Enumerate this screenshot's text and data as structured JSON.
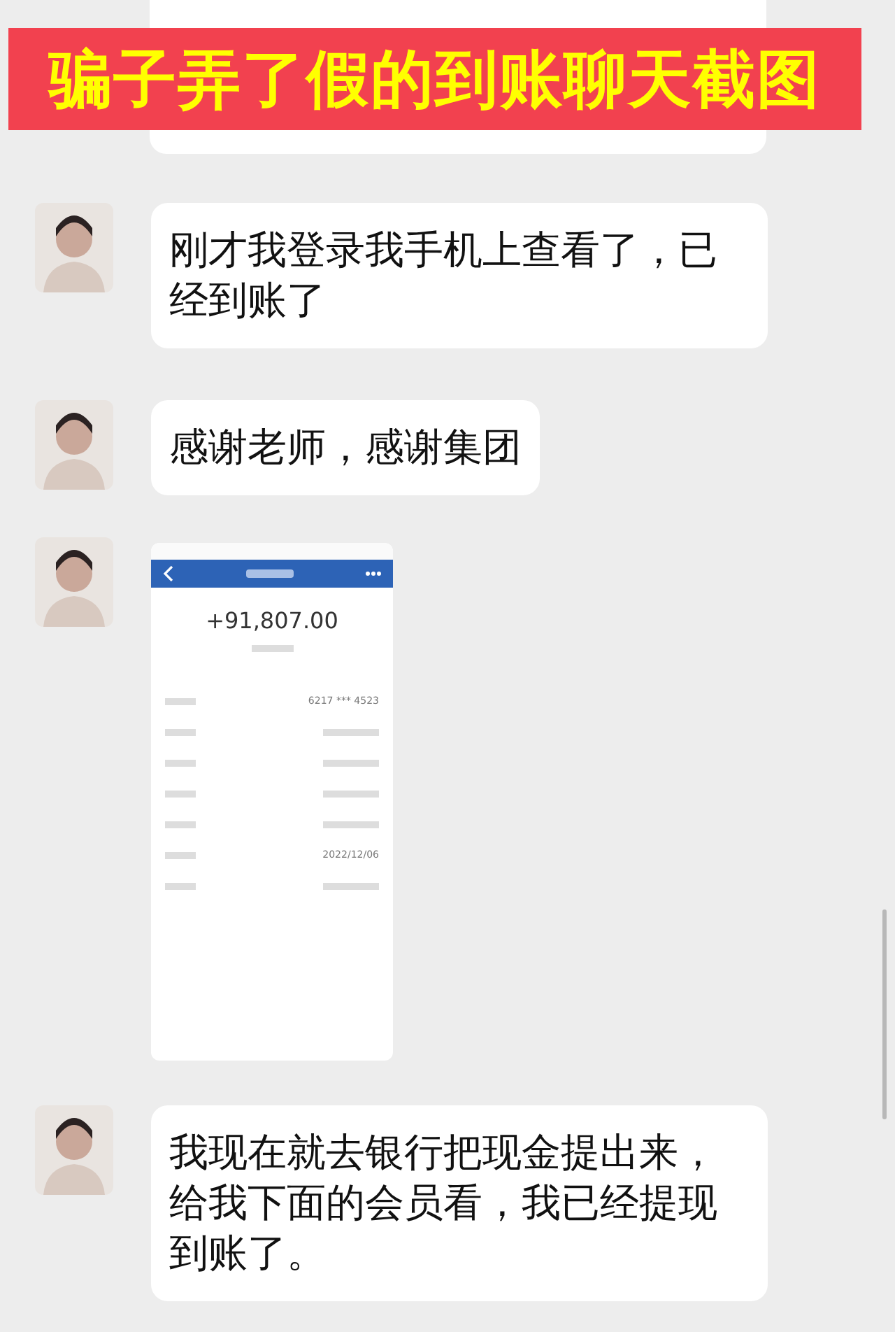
{
  "banner": {
    "title": "骗子弄了假的到账聊天截图"
  },
  "messages": [
    {
      "kind": "text",
      "text": "刚才我登录我手机上查看了，已经到账了"
    },
    {
      "kind": "text",
      "text": "感谢老师，感谢集团"
    },
    {
      "kind": "image",
      "screen": {
        "amount": "+91,807.00",
        "rows": [
          {
            "kind": "value",
            "value": "6217 *** 4523"
          },
          {
            "kind": "blurred"
          },
          {
            "kind": "blurred"
          },
          {
            "kind": "blurred"
          },
          {
            "kind": "blurred"
          },
          {
            "kind": "value",
            "value": "2022/12/06"
          },
          {
            "kind": "blurred"
          }
        ]
      }
    },
    {
      "kind": "text",
      "text": "我现在就去银行把现金提出来，给我下面的会员看，我已经提现到账了。"
    }
  ]
}
